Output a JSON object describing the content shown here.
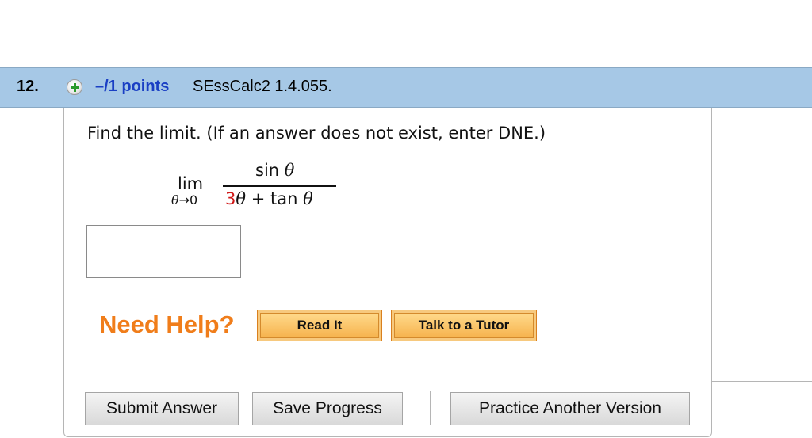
{
  "question": {
    "number": "12.",
    "points": "–/1 points",
    "source": "SEssCalc2 1.4.055.",
    "prompt": "Find the limit. (If an answer does not exist, enter DNE.)"
  },
  "math": {
    "lim": "lim",
    "lim_variable": "θ",
    "lim_arrow": "→",
    "lim_target": "0",
    "numerator_fn": "sin",
    "numerator_var": "θ",
    "denominator_coef": "3",
    "denominator_var": "θ",
    "denominator_op": "+",
    "denominator_fn": "tan",
    "denominator_var2": "θ"
  },
  "answer": {
    "value": ""
  },
  "help": {
    "label": "Need Help?",
    "read_it": "Read It",
    "talk_to_tutor": "Talk to a Tutor"
  },
  "actions": {
    "submit": "Submit Answer",
    "save": "Save Progress",
    "practice": "Practice Another Version"
  },
  "colors": {
    "header_bg": "#a6c8e6",
    "points_text": "#1a3fc4",
    "need_help_text": "#f07d1a",
    "coefficient_highlight": "#d01818",
    "help_button_bg": "#f6b34e"
  },
  "icons": {
    "expand": "plus-circle-icon"
  }
}
